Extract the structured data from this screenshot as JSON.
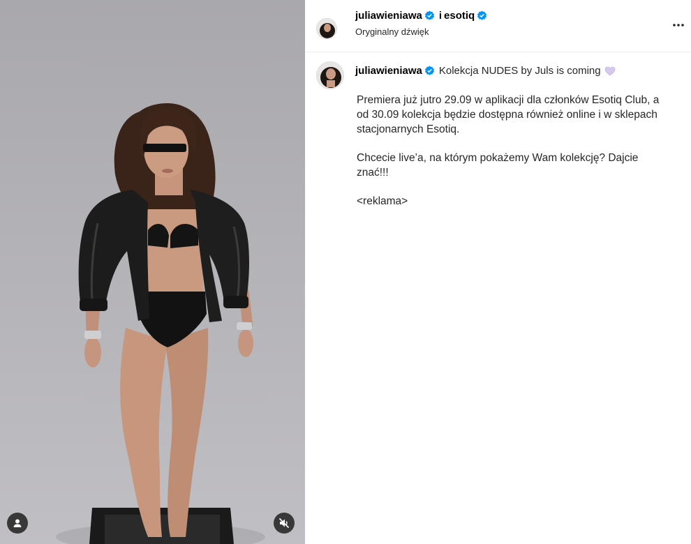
{
  "post": {
    "author": "juliawieniawa",
    "collab_separator": "i",
    "collaborator": "esotiq",
    "audio": "Oryginalny dźwięk",
    "caption": {
      "username": "juliawieniawa",
      "title": "Kolekcja NUDES by Juls is coming",
      "paragraphs": [
        "Premiera już jutro 29.09 w aplikacji dla członków Esotiq Club, a od 30.09 kolekcja będzie dostępna również online i w sklepach stacjonarnych Esotiq.",
        "Chcecie live’a, na którym pokażemy Wam kolekcję? Dajcie znać!!!",
        "<reklama>"
      ]
    }
  },
  "icons": {
    "verified": "verified-badge-icon",
    "more": "more-options-icon",
    "heart": "purple-heart-emoji",
    "tag": "user-tag-icon",
    "mute": "muted-speaker-icon"
  },
  "colors": {
    "verified": "#0095f6",
    "text": "#262626",
    "heart": "#c9b8e6"
  }
}
